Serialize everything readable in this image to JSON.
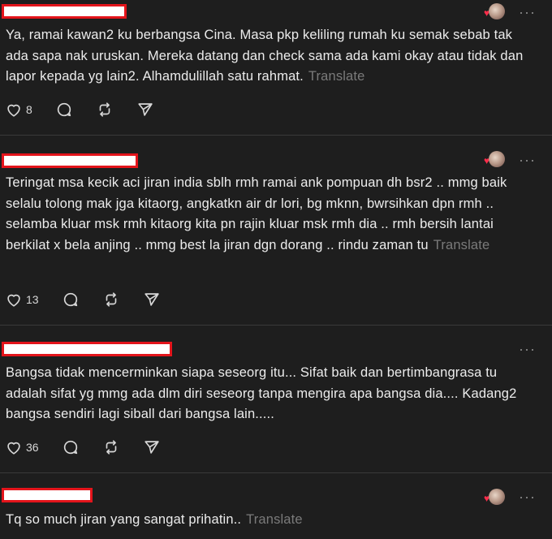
{
  "posts": [
    {
      "text": "Ya, ramai kawan2 ku berbangsa Cina. Masa pkp keliling rumah ku semak sebab tak ada sapa nak uruskan. Mereka datang dan check sama ada kami okay atau tidak dan lapor kepada yg lain2. Alhamdulillah satu rahmat.",
      "translate": "Translate",
      "likes": "8",
      "has_avatar": true
    },
    {
      "text": "Teringat msa kecik aci jiran india sblh rmh ramai ank pompuan dh bsr2 .. mmg baik selalu tolong mak jga kitaorg, angkatkn air dr lori, bg mknn, bwrsihkan dpn rmh .. selamba kluar msk rmh kitaorg kita pn rajin kluar msk rmh dia .. rmh bersih lantai berkilat x bela anjing .. mmg best la jiran dgn dorang .. rindu zaman tu",
      "translate": "Translate",
      "likes": "13",
      "has_avatar": true
    },
    {
      "text": "Bangsa tidak mencerminkan siapa seseorg itu... Sifat baik dan bertimbangrasa tu adalah sifat yg mmg ada dlm diri seseorg tanpa mengira apa bangsa dia.... Kadang2 bangsa sendiri lagi siball dari bangsa lain.....",
      "translate": "",
      "likes": "36",
      "has_avatar": false
    },
    {
      "text": "Tq so much jiran yang sangat prihatin..",
      "translate": "Translate",
      "likes": "",
      "has_avatar": true
    }
  ],
  "icons": {
    "like": "heart-outline-icon",
    "comment": "comment-bubble-icon",
    "repost": "repost-arrows-icon",
    "share": "send-arrow-icon",
    "more": "more-dots-icon"
  },
  "colors": {
    "background": "#1e1e1e",
    "text": "#ececec",
    "muted": "#7a7a7a",
    "redaction_border": "#e3141b",
    "heart_badge": "#ff2d4b"
  },
  "more_label": "···",
  "heart_badge_glyph": "♥"
}
